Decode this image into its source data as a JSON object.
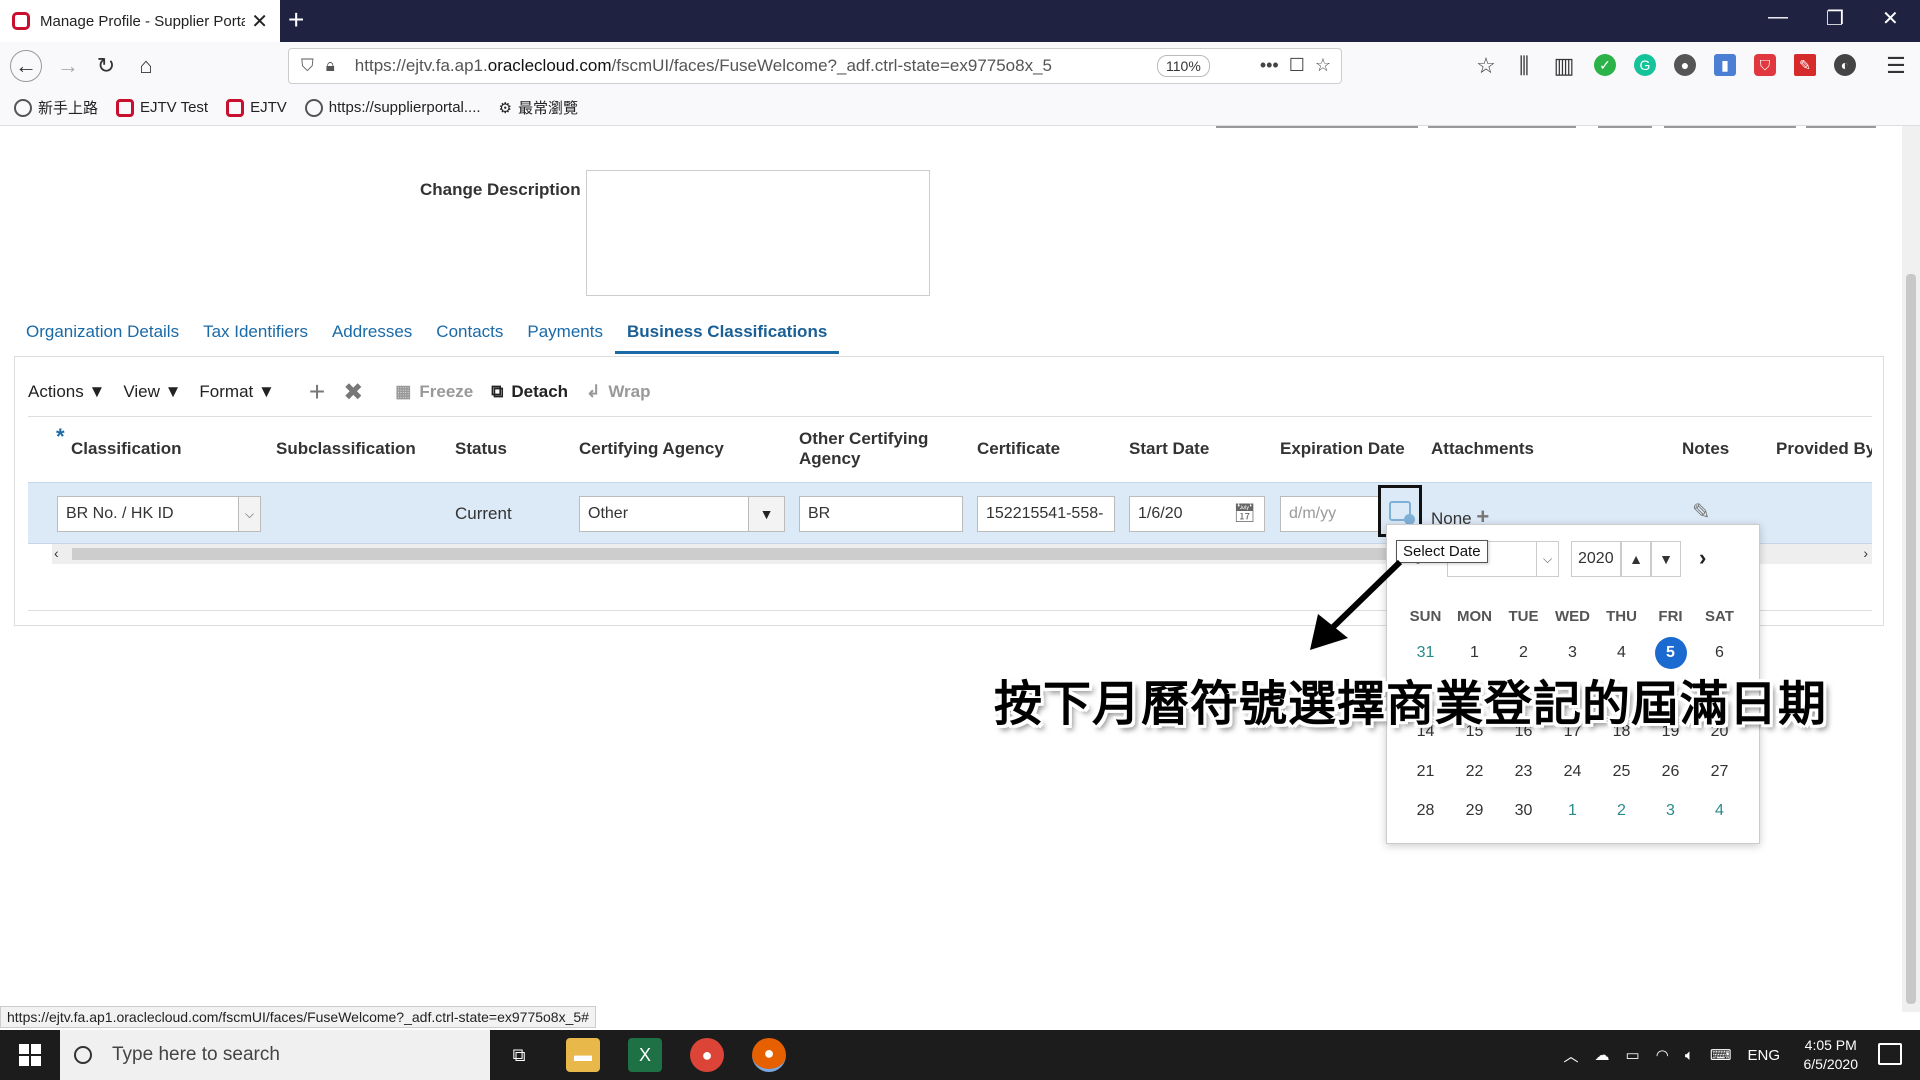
{
  "browser": {
    "tab_title": "Manage Profile - Supplier Portal",
    "url_prefix": "https://ejtv.fa.ap1.",
    "url_host": "oraclecloud.com",
    "url_path": "/fscmUI/faces/FuseWelcome?_adf.ctrl-state=ex9775o8x_5",
    "zoom": "110%",
    "bookmarks": [
      "新手上路",
      "EJTV Test",
      "EJTV",
      "https://supplierportal....",
      "最常瀏覽"
    ]
  },
  "form": {
    "change_description_label": "Change Description"
  },
  "tabs": [
    "Organization Details",
    "Tax Identifiers",
    "Addresses",
    "Contacts",
    "Payments",
    "Business Classifications"
  ],
  "toolbar": {
    "actions": "Actions",
    "view": "View",
    "format": "Format",
    "freeze": "Freeze",
    "detach": "Detach",
    "wrap": "Wrap"
  },
  "table": {
    "columns": {
      "required_mark": "*",
      "classification": "Classification",
      "subclassification": "Subclassification",
      "status": "Status",
      "certifying_agency": "Certifying Agency",
      "other_certifying_agency_1": "Other Certifying",
      "other_certifying_agency_2": "Agency",
      "certificate": "Certificate",
      "start_date": "Start Date",
      "expiration_date": "Expiration Date",
      "attachments": "Attachments",
      "notes": "Notes",
      "provided_by": "Provided By"
    },
    "row": {
      "classification": "BR No. / HK ID",
      "status": "Current",
      "certifying_agency": "Other",
      "other_certifying_agency": "BR",
      "certificate": "152215541-558-",
      "start_date": "1/6/20",
      "expiration_placeholder": "d/m/yy",
      "attachments": "None"
    }
  },
  "tooltip": "Select Date",
  "datepicker": {
    "year": "2020",
    "weekdays": [
      "SUN",
      "MON",
      "TUE",
      "WED",
      "THU",
      "FRI",
      "SAT"
    ],
    "weeks": [
      [
        "31",
        "1",
        "2",
        "3",
        "4",
        "5",
        "6"
      ],
      [
        "",
        "",
        "",
        "",
        "",
        "",
        ""
      ],
      [
        "14",
        "15",
        "16",
        "17",
        "18",
        "19",
        "20"
      ],
      [
        "21",
        "22",
        "23",
        "24",
        "25",
        "26",
        "27"
      ],
      [
        "28",
        "29",
        "30",
        "1",
        "2",
        "3",
        "4"
      ]
    ],
    "selected_day": "5"
  },
  "annotation": "按下月曆符號選擇商業登記的屆滿日期",
  "status_url": "https://ejtv.fa.ap1.oraclecloud.com/fscmUI/faces/FuseWelcome?_adf.ctrl-state=ex9775o8x_5#",
  "taskbar": {
    "search_placeholder": "Type here to search",
    "lang": "ENG",
    "time": "4:05 PM",
    "date": "6/5/2020"
  }
}
